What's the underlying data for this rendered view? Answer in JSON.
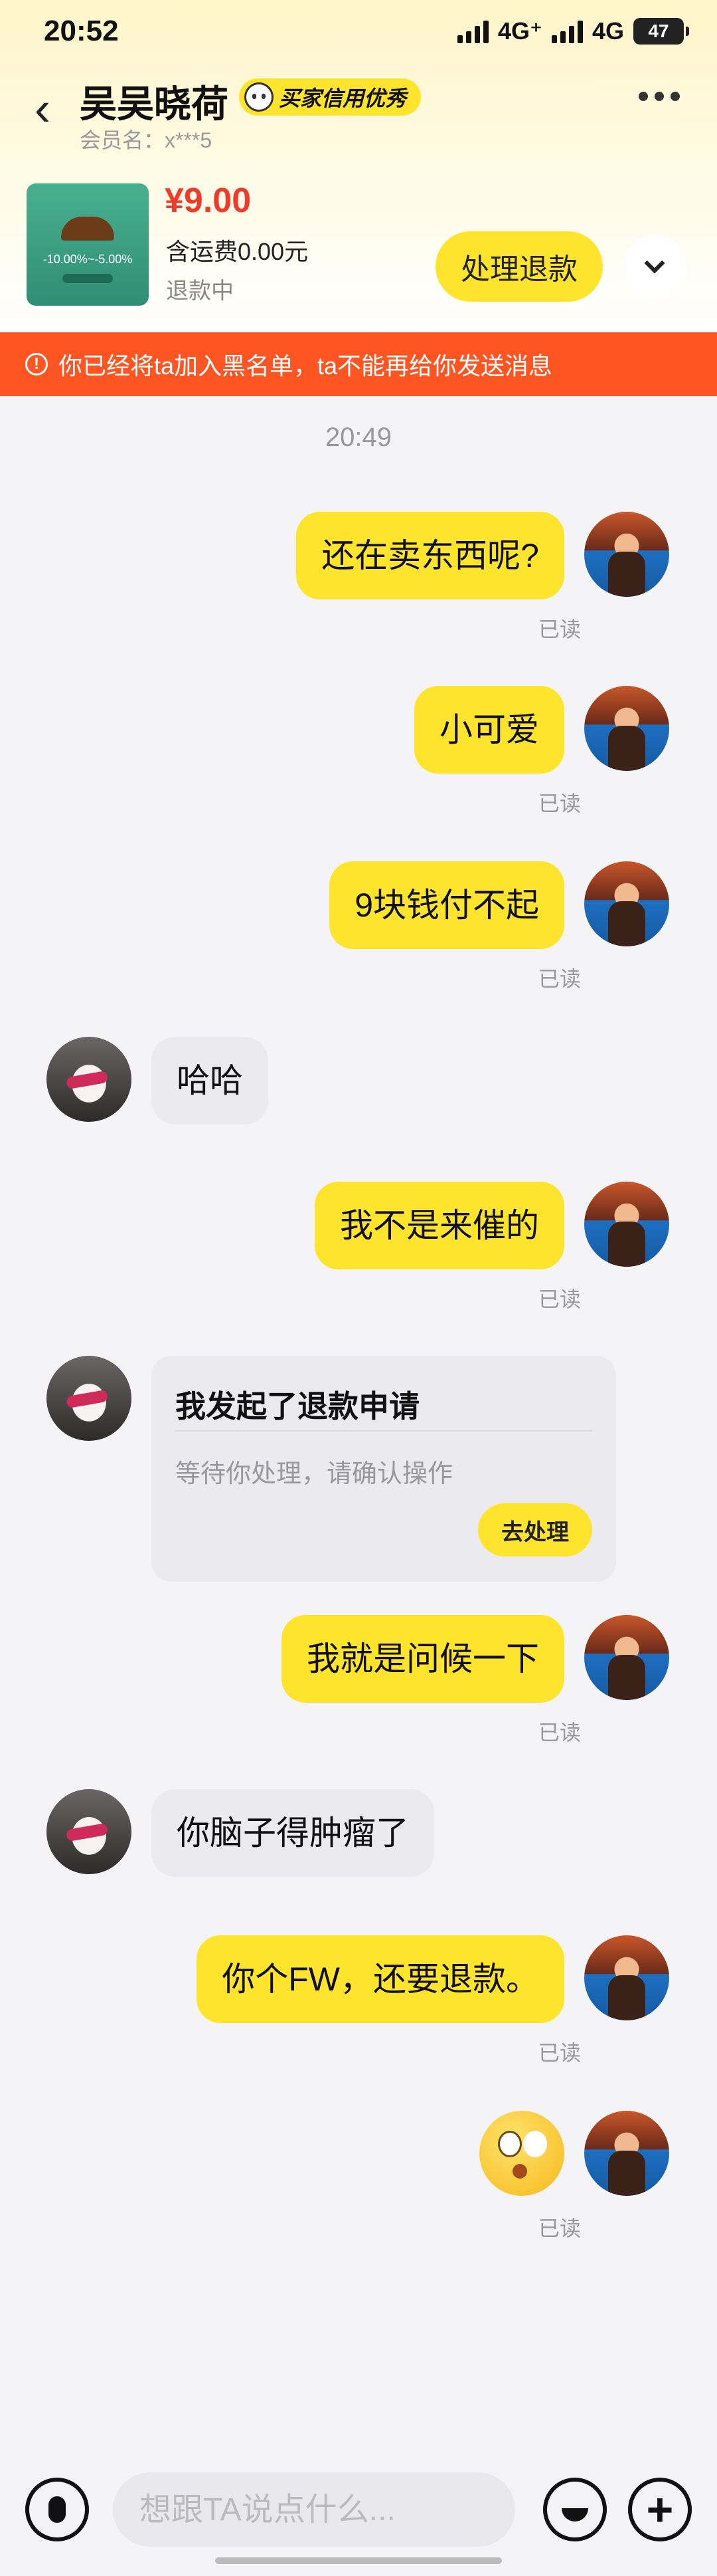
{
  "status": {
    "time": "20:52",
    "net1": "4G⁺",
    "net2": "4G",
    "battery": "47"
  },
  "header": {
    "title": "吴吴晓荷",
    "badge": "买家信用优秀",
    "member": "会员名：x***5"
  },
  "product": {
    "price": "¥9.00",
    "shipping": "含运费0.00元",
    "status": "退款中",
    "action_label": "处理退款",
    "thumb_text": "-10.00%~-5.00%"
  },
  "alert": {
    "text": "你已经将ta加入黑名单，ta不能再给你发送消息"
  },
  "timestamp": "20:49",
  "messages": {
    "m1": {
      "text": "还在卖东西呢?",
      "read": "已读"
    },
    "m2": {
      "text": "小可爱",
      "read": "已读"
    },
    "m3": {
      "text": "9块钱付不起",
      "read": "已读"
    },
    "m4": {
      "text": "哈哈"
    },
    "m5": {
      "text": "我不是来催的",
      "read": "已读"
    },
    "card": {
      "title": "我发起了退款申请",
      "subtitle": "等待你处理，请确认操作",
      "button": "去处理"
    },
    "m6": {
      "text": "我就是问候一下",
      "read": "已读"
    },
    "m7": {
      "text": "你脑子得肿瘤了"
    },
    "m8": {
      "text": "你个FW，还要退款。",
      "read": "已读"
    },
    "m9": {
      "emoji": "face-with-rolling-eyes",
      "read": "已读"
    }
  },
  "composer": {
    "placeholder": "想跟TA说点什么..."
  },
  "colors": {
    "accent": "#ffe42e",
    "alert": "#ff5522",
    "price": "#f03a2a"
  }
}
